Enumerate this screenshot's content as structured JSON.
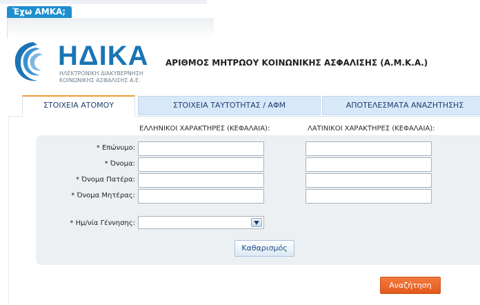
{
  "banner": {
    "tab_label": "Έχω ΑΜΚΑ;"
  },
  "logo": {
    "name": "ΗΔΙΚΑ",
    "subtitle_line1": "ΗΛΕΚΤΡΟΝΙΚΗ ΔΙΑΚΥΒΕΡΝΗΣΗ",
    "subtitle_line2": "ΚΟΙΝΩΝΙΚΗΣ ΑΣΦΑΛΙΣΗΣ Α.Ε."
  },
  "page_title": "ΑΡΙΘΜΟΣ ΜΗΤΡΩΟΥ ΚΟΙΝΩΝΙΚΗΣ ΑΣΦΑΛΙΣΗΣ (Α.Μ.Κ.Α.)",
  "tabs": [
    {
      "label": "ΣΤΟΙΧΕΙΑ ΑΤΟΜΟΥ",
      "active": true
    },
    {
      "label": "ΣΤΟΙΧΕΙΑ ΤΑΥΤΟΤΗΤΑΣ / ΑΦΜ",
      "active": false
    },
    {
      "label": "ΑΠΟΤΕΛΕΣΜΑΤΑ ΑΝΑΖΗΤΗΣΗΣ",
      "active": false
    }
  ],
  "columns": {
    "greek_header": "ΕΛΛΗΝΙΚΟΙ ΧΑΡΑΚΤΗΡΕΣ (ΚΕΦΑΛΑΙΑ):",
    "latin_header": "ΛΑΤΙΝΙΚΟΙ ΧΑΡΑΚΤΗΡΕΣ (ΚΕΦΑΛΑΙΑ):"
  },
  "fields": [
    {
      "label": "* Επώνυμο:",
      "greek_value": "",
      "latin_value": ""
    },
    {
      "label": "* Όνομα:",
      "greek_value": "",
      "latin_value": ""
    },
    {
      "label": "* Όνομα Πατέρα:",
      "greek_value": "",
      "latin_value": ""
    },
    {
      "label": "* Όνομα Μητέρας:",
      "greek_value": "",
      "latin_value": ""
    }
  ],
  "birthdate": {
    "label": "* Ημ/νία Γέννησης:",
    "value": ""
  },
  "buttons": {
    "clear": "Καθαρισμός",
    "search": "Αναζήτηση"
  },
  "colors": {
    "brand_blue": "#1a74b6",
    "tab_bg": "#d7e8f8",
    "active_tab_accent": "#f09a33",
    "search_button": "#e8662a",
    "panel_bg": "#edf0f2"
  },
  "icons": {
    "dropdown": "chevron-down-icon"
  }
}
